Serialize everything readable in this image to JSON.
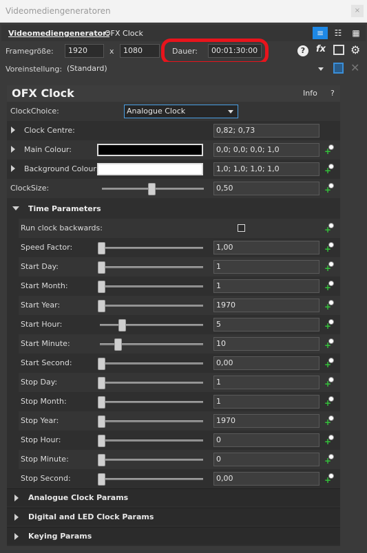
{
  "window": {
    "title": "Videomediengeneratoren",
    "close": "×"
  },
  "generator": {
    "label": "Videomediengenerator:",
    "fx": "OFX Clock"
  },
  "frame": {
    "size_label": "Framegröße:",
    "width": "1920",
    "x": "x",
    "height": "1080",
    "duration_label": "Dauer:",
    "duration": "00:01:30:00"
  },
  "preset": {
    "label": "Voreinstellung:",
    "value": "(Standard)"
  },
  "panel": {
    "title": "OFX Clock",
    "info": "Info",
    "help": "?"
  },
  "params": {
    "clock_choice": {
      "label": "ClockChoice:",
      "value": "Analogue Clock"
    },
    "clock_centre": {
      "label": "Clock Centre:",
      "value": "0,82; 0,73"
    },
    "main_colour": {
      "label": "Main Colour:",
      "value": "0,0; 0,0; 0,0; 1,0",
      "swatch": "#000000"
    },
    "bg_colour": {
      "label": "Background Colour:",
      "value": "1,0; 1,0; 1,0; 1,0",
      "swatch": "#ffffff"
    },
    "clock_size": {
      "label": "ClockSize:",
      "value": "0,50"
    }
  },
  "time_section": {
    "title": "Time Parameters"
  },
  "time_params": [
    {
      "label": "Run clock backwards:",
      "type": "checkbox"
    },
    {
      "label": "Speed Factor:",
      "value": "1,00",
      "pos": 0
    },
    {
      "label": "Start Day:",
      "value": "1",
      "pos": 0
    },
    {
      "label": "Start Month:",
      "value": "1",
      "pos": 0
    },
    {
      "label": "Start Year:",
      "value": "1970",
      "pos": 0
    },
    {
      "label": "Start Hour:",
      "value": "5",
      "pos": 0.2
    },
    {
      "label": "Start Minute:",
      "value": "10",
      "pos": 0.16
    },
    {
      "label": "Start Second:",
      "value": "0,00",
      "pos": 0
    },
    {
      "label": "Stop Day:",
      "value": "1",
      "pos": 0
    },
    {
      "label": "Stop Month:",
      "value": "1",
      "pos": 0
    },
    {
      "label": "Stop Year:",
      "value": "1970",
      "pos": 0
    },
    {
      "label": "Stop Hour:",
      "value": "0",
      "pos": 0
    },
    {
      "label": "Stop Minute:",
      "value": "0",
      "pos": 0
    },
    {
      "label": "Stop Second:",
      "value": "0,00",
      "pos": 0
    }
  ],
  "sections": [
    "Analogue Clock Params",
    "Digital and LED Clock Params",
    "Keying Params"
  ],
  "colors": {
    "accent": "#1e88e5",
    "highlight": "#e8141c",
    "keyframe": "#33c23a"
  }
}
